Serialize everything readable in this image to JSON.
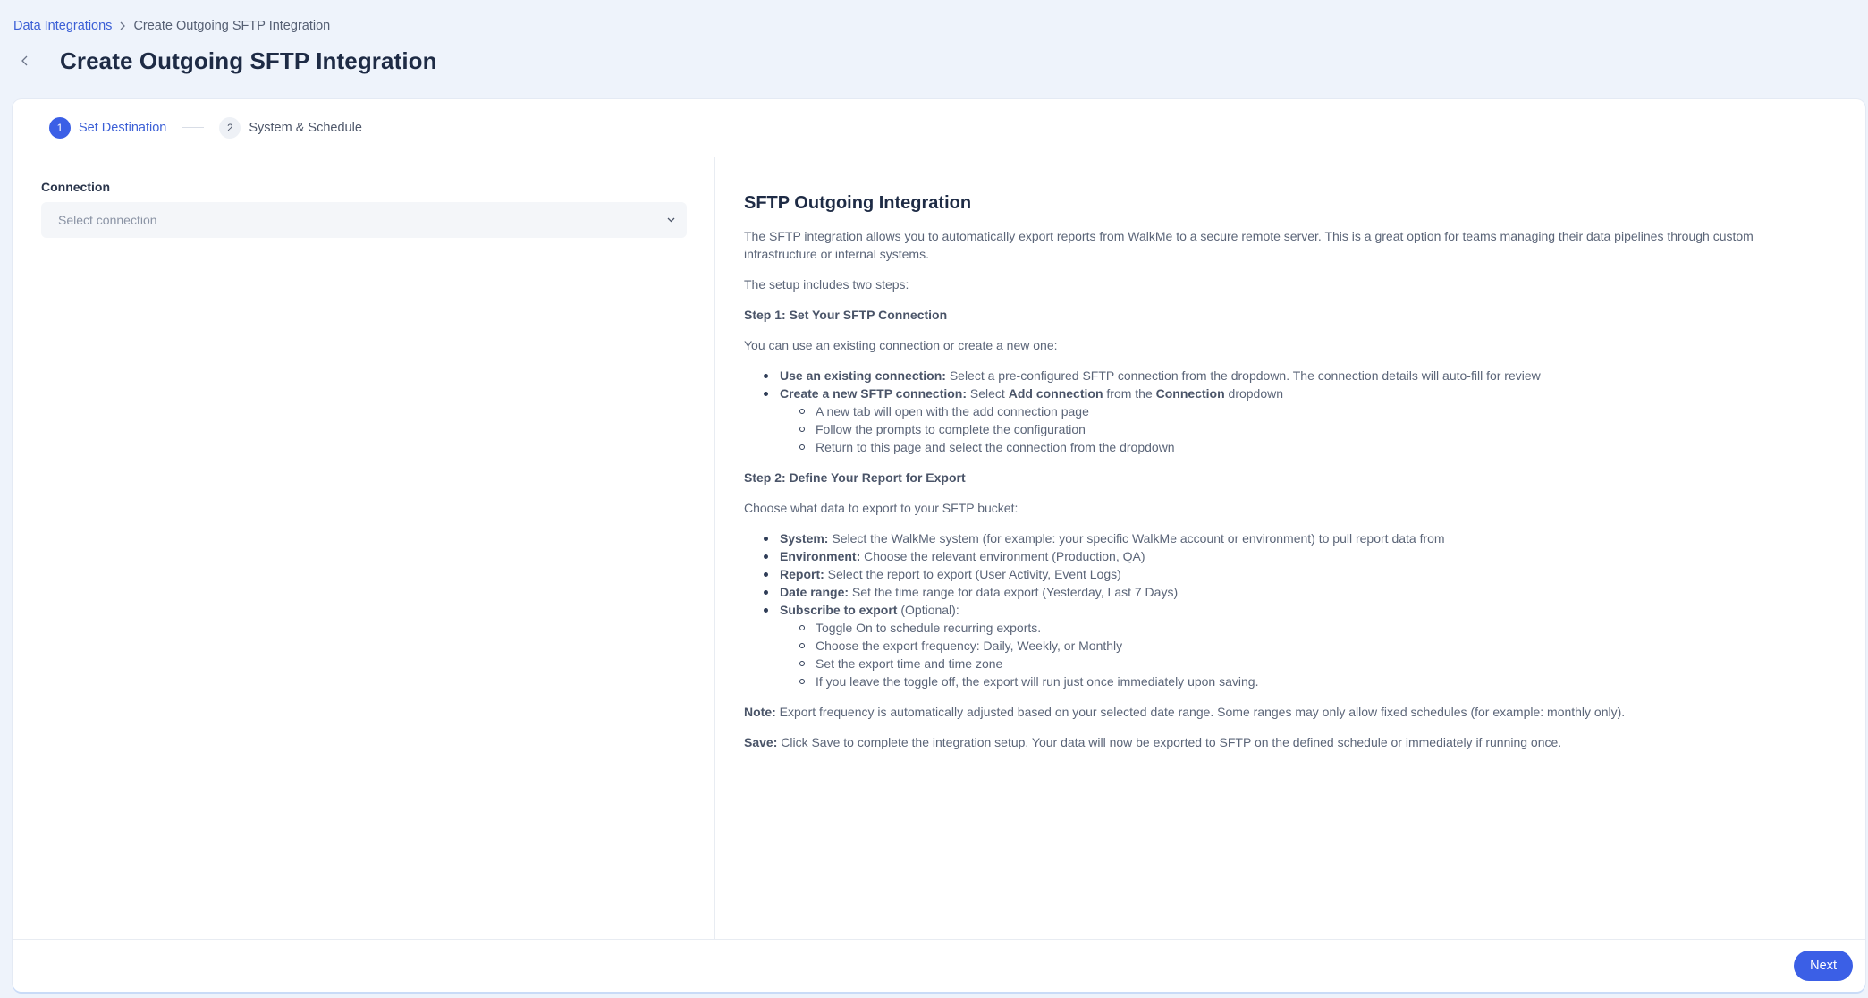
{
  "breadcrumb": {
    "root": "Data Integrations",
    "current": "Create Outgoing SFTP Integration"
  },
  "header": {
    "title": "Create Outgoing SFTP Integration",
    "back_icon": "chevron-left-icon"
  },
  "stepper": {
    "steps": [
      {
        "number": "1",
        "label": "Set Destination",
        "state": "active"
      },
      {
        "number": "2",
        "label": "System & Schedule",
        "state": "inactive"
      }
    ]
  },
  "form": {
    "connection_label": "Connection",
    "connection_placeholder": "Select connection"
  },
  "info": {
    "title": "SFTP Outgoing Integration",
    "intro": "The SFTP integration allows you to automatically export reports from WalkMe to a secure remote server. This is a great option for teams managing their data pipelines through custom infrastructure or internal systems.",
    "setup": "The setup includes two steps:",
    "step1_title": "Step 1: Set Your SFTP Connection",
    "step1_intro": "You can use an existing connection or create a new one:",
    "step1_items": [
      {
        "bold": "Use an existing connection:",
        "text": " Select a pre-configured SFTP connection from the dropdown. The connection details will auto-fill for review"
      },
      {
        "bold": "Create a new SFTP connection:",
        "text_a": " Select ",
        "bold_b": "Add connection",
        "text_c": " from the ",
        "bold_d": "Connection",
        "text_e": " dropdown"
      }
    ],
    "step1_subitems": [
      "A new tab will open with the add connection page",
      "Follow the prompts to complete the configuration",
      "Return to this page and select the connection from the dropdown"
    ],
    "step2_title": "Step 2: Define Your Report for Export",
    "step2_intro": "Choose what data to export to your SFTP bucket:",
    "step2_items": [
      {
        "bold": "System:",
        "text": " Select the WalkMe system (for example: your specific WalkMe account or environment) to pull report data from"
      },
      {
        "bold": "Environment:",
        "text": " Choose the relevant environment (Production, QA)"
      },
      {
        "bold": "Report:",
        "text": " Select the report to export (User Activity, Event Logs)"
      },
      {
        "bold": "Date range:",
        "text": " Set the time range for data export (Yesterday, Last 7 Days)"
      },
      {
        "bold": "Subscribe to export",
        "text": " (Optional):"
      }
    ],
    "step2_subitems": [
      "Toggle On to schedule recurring exports.",
      "Choose the export frequency: Daily, Weekly, or Monthly",
      "Set the export time and time zone",
      "If you leave the toggle off, the export will run just once immediately upon saving."
    ],
    "note_label": "Note:",
    "note_text": " Export frequency is automatically adjusted based on your selected date range. Some ranges may only allow fixed schedules (for example: monthly only).",
    "save_label": "Save:",
    "save_text": " Click Save to complete the integration setup. Your data will now be exported to SFTP on the defined schedule or immediately if running once."
  },
  "footer": {
    "next_label": "Next"
  },
  "colors": {
    "accent": "#3b5fe6",
    "background": "#eef3fb"
  }
}
